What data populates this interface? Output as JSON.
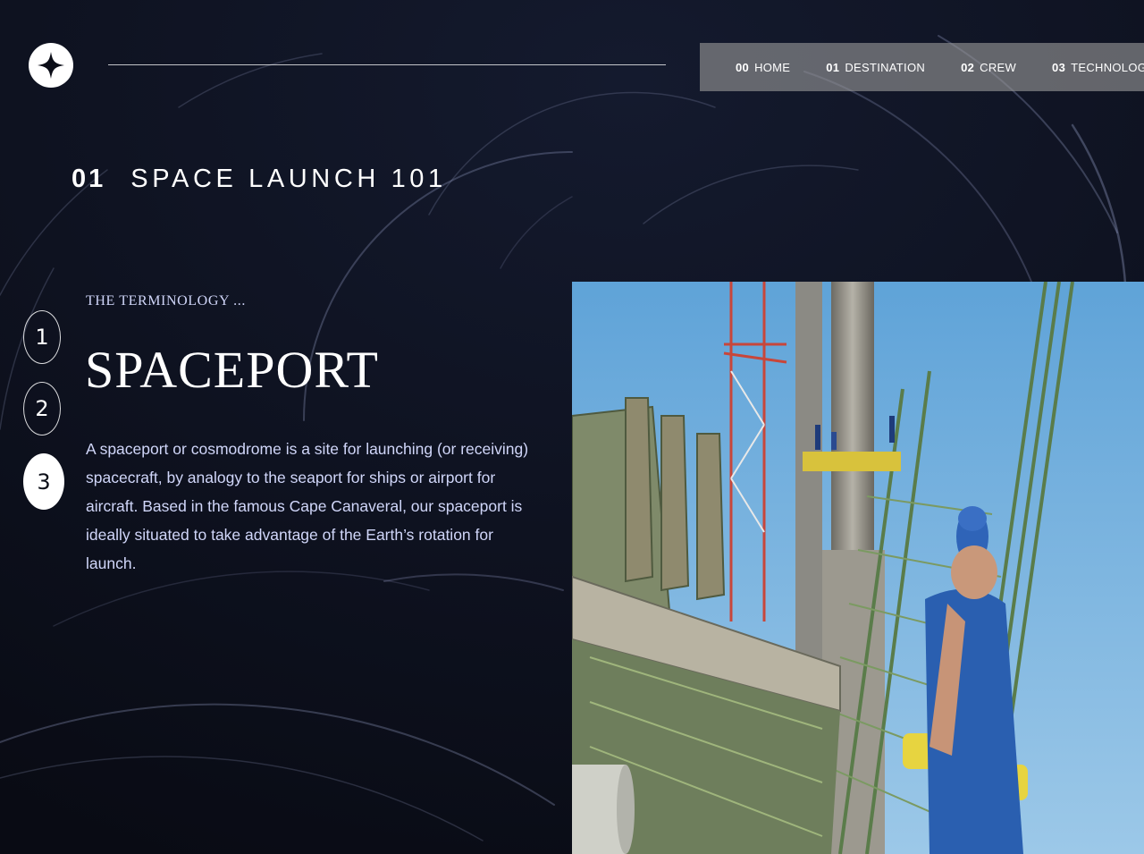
{
  "nav": {
    "items": [
      {
        "num": "00",
        "label": "HOME"
      },
      {
        "num": "01",
        "label": "DESTINATION"
      },
      {
        "num": "02",
        "label": "CREW"
      },
      {
        "num": "03",
        "label": "TECHNOLOGY"
      }
    ]
  },
  "header": {
    "number": "01",
    "title": "SPACE LAUNCH 101"
  },
  "steps": [
    "1",
    "2",
    "3"
  ],
  "active_step": 3,
  "content": {
    "eyebrow": "THE TERMINOLOGY ...",
    "term": "SPACEPORT",
    "description": "A spaceport or cosmodrome is a site for launching (or receiving) spacecraft, by analogy to the seaport for ships or airport for aircraft. Based in the famous Cape Canaveral, our spaceport is ideally situated to take advantage of the Earth’s rotation for launch."
  },
  "colors": {
    "background": "#0b0d17",
    "accent": "#d0d6f9",
    "nav_bg": "rgba(151,151,151,0.62)"
  },
  "icons": {
    "logo": "star-logo-icon"
  }
}
